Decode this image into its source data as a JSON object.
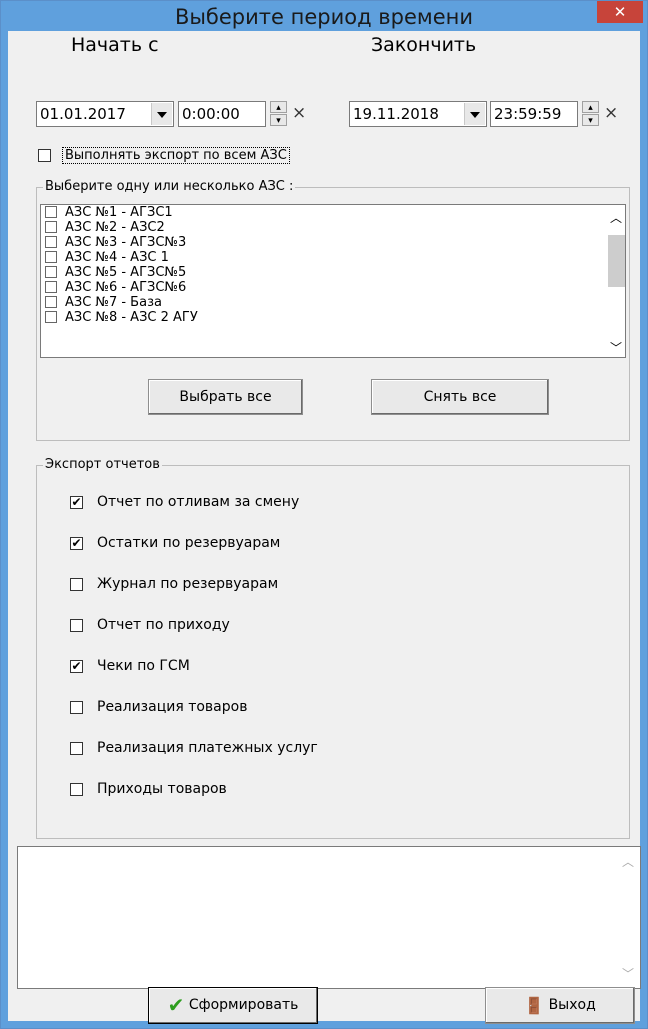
{
  "window": {
    "title": "Выберите период времени",
    "close_glyph": "✕"
  },
  "start": {
    "label": "Начать с",
    "date": "01.01.2017",
    "time": "0:00:00",
    "clear": "×"
  },
  "end": {
    "label": "Закончить",
    "date": "19.11.2018",
    "time": "23:59:59",
    "clear": "×"
  },
  "export_all": {
    "label": "Выполнять экспорт по всем АЗС",
    "checked": false
  },
  "stations_group": {
    "title": "Выберите одну или несколько АЗС :",
    "items": [
      "АЗС №1 - АГЗС1",
      "АЗС №2 - АЗС2",
      "АЗС №3 - АГЗС№3",
      "АЗС №4 - АЗС 1",
      "АЗС №5 - АГЗС№5",
      "АЗС №6 - АГЗС№6",
      "АЗС №7 - База",
      "АЗС №8 - АЗС 2 АГУ"
    ],
    "select_all": "Выбрать все",
    "clear_all": "Снять все"
  },
  "reports_group": {
    "title": "Экспорт отчетов",
    "items": [
      {
        "label": "Отчет по отливам за смену",
        "checked": true,
        "mark": "✔"
      },
      {
        "label": "Остатки по резервуарам",
        "checked": true,
        "mark": "✔"
      },
      {
        "label": "Журнал по резервуарам",
        "checked": false,
        "mark": ""
      },
      {
        "label": "Отчет по приходу",
        "checked": false,
        "mark": ""
      },
      {
        "label": "Чеки по ГСМ",
        "checked": true,
        "mark": "✔"
      },
      {
        "label": "Реализация товаров",
        "checked": false,
        "mark": ""
      },
      {
        "label": "Реализация платежных услуг",
        "checked": false,
        "mark": ""
      },
      {
        "label": "Приходы товаров",
        "checked": false,
        "mark": ""
      }
    ]
  },
  "footer": {
    "generate": "Сформировать",
    "exit": "Выход"
  },
  "icons": {
    "generate": "green-checkmark-icon",
    "exit": "door-exit-icon"
  },
  "colors": {
    "titlebar": "#5fa0dd",
    "close": "#c7443a",
    "check_green": "#2e9e1f"
  }
}
